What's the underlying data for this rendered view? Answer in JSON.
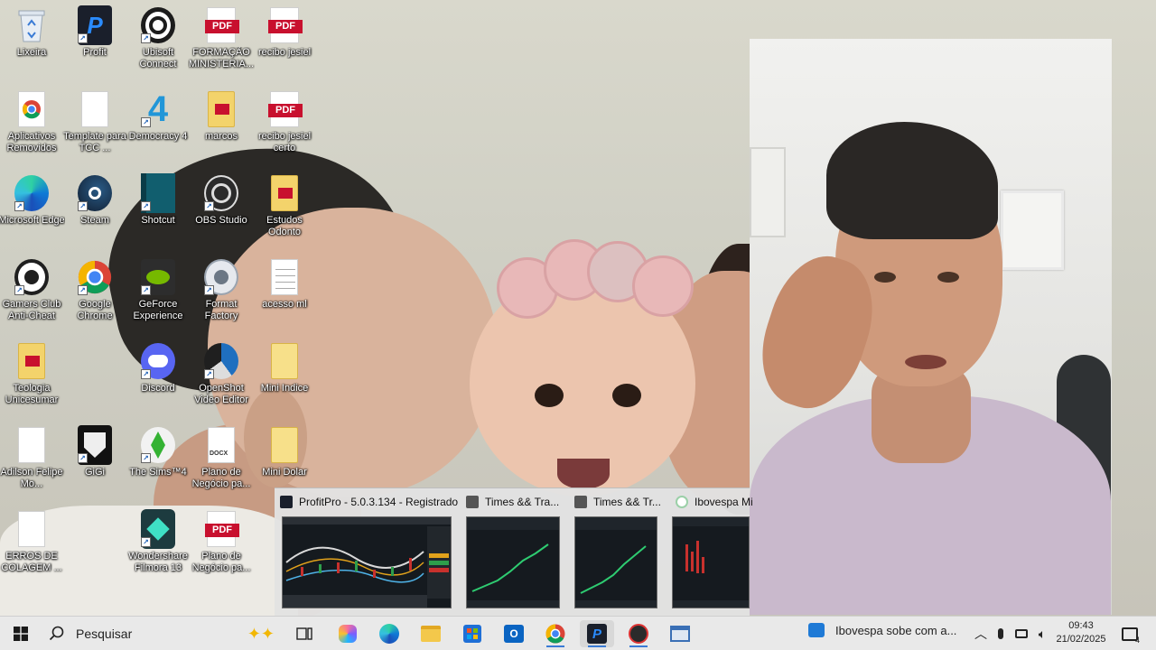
{
  "desktop": {
    "icons": [
      {
        "label": "Lixeira",
        "icon": "recycle-bin-icon"
      },
      {
        "label": "Profit",
        "icon": "profit-icon"
      },
      {
        "label": "Ubisoft Connect",
        "icon": "ubisoft-icon"
      },
      {
        "label": "FORMAÇÃO MINISTERIA...",
        "icon": "pdf-icon"
      },
      {
        "label": "recibo jesiel",
        "icon": "pdf-icon"
      },
      {
        "label": "Aplicativos Removidos",
        "icon": "chrome-doc-icon"
      },
      {
        "label": "Template para TCC ...",
        "icon": "blank-document-icon"
      },
      {
        "label": "Democracy 4",
        "icon": "democracy-icon"
      },
      {
        "label": "marcos",
        "icon": "pdf-folder-icon"
      },
      {
        "label": "recibo jesiel certo",
        "icon": "pdf-icon"
      },
      {
        "label": "Microsoft Edge",
        "icon": "edge-icon"
      },
      {
        "label": "Steam",
        "icon": "steam-icon"
      },
      {
        "label": "Shotcut",
        "icon": "shotcut-icon"
      },
      {
        "label": "OBS Studio",
        "icon": "obs-icon"
      },
      {
        "label": "Estudos Odonto",
        "icon": "pdf-folder-icon"
      },
      {
        "label": "Gamers Club Anti-Cheat",
        "icon": "gamers-club-icon"
      },
      {
        "label": "Google Chrome",
        "icon": "chrome-icon"
      },
      {
        "label": "GeForce Experience",
        "icon": "geforce-icon"
      },
      {
        "label": "Format Factory",
        "icon": "format-factory-icon"
      },
      {
        "label": "acesso ml",
        "icon": "text-document-icon"
      },
      {
        "label": "Teologia Unicesumar",
        "icon": "pdf-folder-icon"
      },
      {
        "label": "Discord",
        "icon": "discord-icon"
      },
      {
        "label": "OpenShot Video Editor",
        "icon": "openshot-icon"
      },
      {
        "label": "Mini Indice",
        "icon": "folder-icon"
      },
      {
        "label": "Adilson Felipe Mo...",
        "icon": "blank-document-icon"
      },
      {
        "label": "GiGi",
        "icon": "gigi-icon"
      },
      {
        "label": "The Sims™4",
        "icon": "sims-icon"
      },
      {
        "label": "Plano de Negócio pa...",
        "icon": "docx-icon"
      },
      {
        "label": "Mini Dolar",
        "icon": "folder-icon"
      },
      {
        "label": "ERROS DE COLAGEM ...",
        "icon": "blank-document-icon"
      },
      {
        "label": "Wondershare Filmora 13",
        "icon": "filmora-icon"
      },
      {
        "label": "Plano de Negócio pa...",
        "icon": "pdf-icon"
      }
    ],
    "pdf_badge": "PDF",
    "docx_badge": "DOCX"
  },
  "thumbnails": [
    {
      "title": "ProfitPro - 5.0.3.134 - Registrado"
    },
    {
      "title": "Times && Tra..."
    },
    {
      "title": "Times && Tr..."
    },
    {
      "title": "Ibovespa Mi"
    }
  ],
  "taskbar": {
    "search_placeholder": "Pesquisar",
    "news_text": "Ibovespa sobe com a...",
    "time": "09:43",
    "date": "21/02/2025",
    "notification_count": "4"
  },
  "colors": {
    "taskbar_bg": "#e9e9e9",
    "accent": "#3a7bd5",
    "pdf_red": "#c8102e"
  }
}
